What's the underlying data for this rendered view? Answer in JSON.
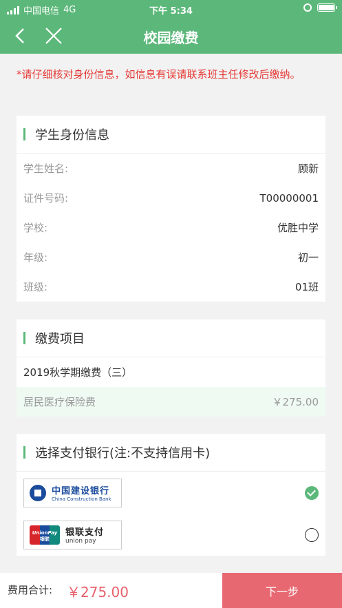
{
  "status_bar": {
    "carrier": "中国电信",
    "network": "4G",
    "time": "下午 5:34"
  },
  "nav": {
    "title": "校园缴费"
  },
  "notice": "*请仔细核对身份信息，如信息有误请联系班主任修改后缴纳。",
  "student_card": {
    "title": "学生身份信息",
    "rows": [
      {
        "label": "学生姓名:",
        "value": "顾新"
      },
      {
        "label": "证件号码:",
        "value": "T00000001"
      },
      {
        "label": "学校:",
        "value": "优胜中学"
      },
      {
        "label": "年级:",
        "value": "初一"
      },
      {
        "label": "班级:",
        "value": "01班"
      }
    ]
  },
  "fee_card": {
    "title": "缴费项目",
    "item": "2019秋学期缴费（三）",
    "sub_label": "居民医疗保险费",
    "sub_amount": "￥275.00"
  },
  "bank_card": {
    "title": "选择支付银行(注:不支持信用卡)",
    "banks": [
      {
        "name_cn": "中国建设银行",
        "name_en": "China Construction Bank",
        "selected": true
      },
      {
        "name_cn": "银联支付",
        "name_en": "union pay",
        "badge": "UnionPay",
        "badge_cn": "银联",
        "selected": false
      }
    ]
  },
  "footer": {
    "total_label": "费用合计:",
    "total_value": "￥275.00",
    "next_label": "下一步"
  },
  "colors": {
    "theme_green": "#5cb87a",
    "alert_red": "#e53935",
    "button_pink": "#e86872"
  }
}
